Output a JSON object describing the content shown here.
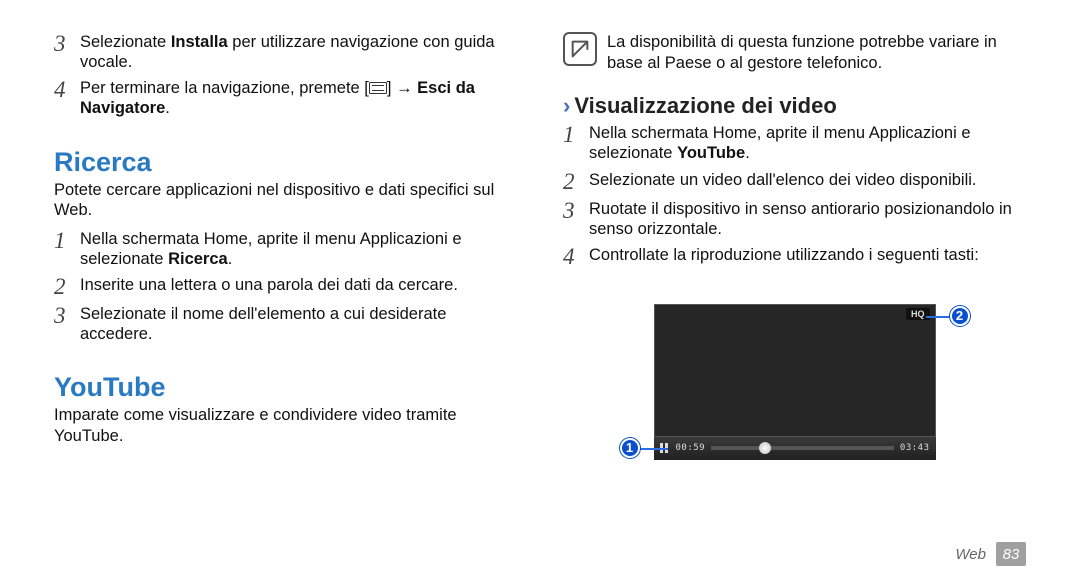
{
  "left": {
    "items_top": [
      {
        "num": "3",
        "text_before": "Selezionate ",
        "bold": "Installa",
        "text_after": " per utilizzare navigazione con guida vocale."
      },
      {
        "num": "4",
        "text_before": "Per terminare la navigazione, premete [",
        "icon": true,
        "text_mid": "] → ",
        "bold": "Esci da Navigatore",
        "text_after": "."
      }
    ],
    "ricerca": {
      "title": "Ricerca",
      "desc": "Potete cercare applicazioni nel dispositivo e dati specifici sul Web.",
      "steps": [
        {
          "num": "1",
          "text_before": "Nella schermata Home, aprite il menu Applicazioni e selezionate ",
          "bold": "Ricerca",
          "text_after": "."
        },
        {
          "num": "2",
          "text_before": "Inserite una lettera o una parola dei dati da cercare.",
          "bold": "",
          "text_after": ""
        },
        {
          "num": "3",
          "text_before": "Selezionate il nome dell'elemento a cui desiderate accedere.",
          "bold": "",
          "text_after": ""
        }
      ]
    },
    "youtube": {
      "title": "YouTube",
      "desc": "Imparate come visualizzare e condividere video tramite YouTube."
    }
  },
  "right": {
    "note": "La disponibilità di questa funzione potrebbe variare in base al Paese o al gestore telefonico.",
    "subsection_title": "Visualizzazione dei video",
    "steps": [
      {
        "num": "1",
        "text_before": "Nella schermata Home, aprite il menu Applicazioni e selezionate ",
        "bold": "YouTube",
        "text_after": "."
      },
      {
        "num": "2",
        "text_before": "Selezionate un video dall'elenco dei video disponibili.",
        "bold": "",
        "text_after": ""
      },
      {
        "num": "3",
        "text_before": "Ruotate il dispositivo in senso antiorario posizionandolo in senso orizzontale.",
        "bold": "",
        "text_after": ""
      },
      {
        "num": "4",
        "text_before": "Controllate la riproduzione utilizzando i seguenti tasti:",
        "bold": "",
        "text_after": ""
      }
    ],
    "video": {
      "hq": "HQ",
      "time_current": "00:59",
      "time_total": "03:43",
      "callouts": {
        "one": "1",
        "two": "2"
      }
    }
  },
  "footer": {
    "section": "Web",
    "page": "83"
  }
}
